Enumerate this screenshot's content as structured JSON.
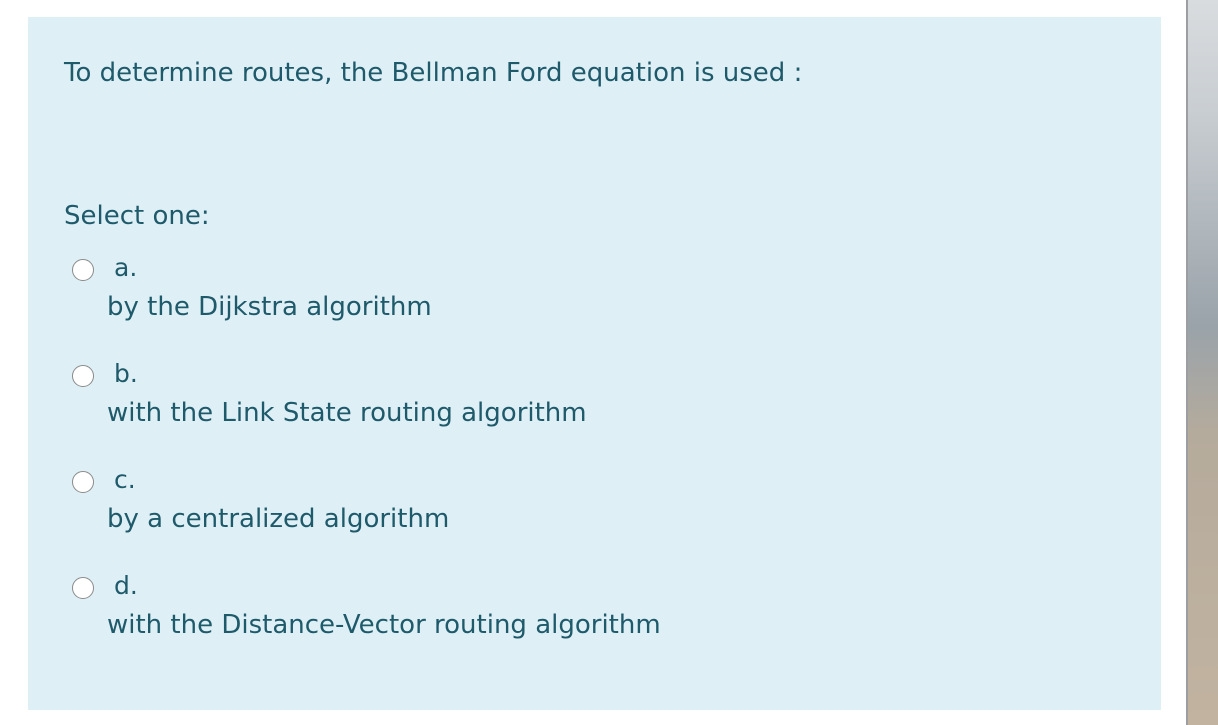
{
  "question": {
    "text": "To determine routes, the Bellman Ford equation is used :",
    "prompt": "Select one:"
  },
  "options": [
    {
      "letter": "a.",
      "text": "by the Dijkstra algorithm",
      "selected": false
    },
    {
      "letter": "b.",
      "text": "with the Link State routing algorithm",
      "selected": false
    },
    {
      "letter": "c.",
      "text": "by a centralized algorithm",
      "selected": false
    },
    {
      "letter": "d.",
      "text": "with the Distance-Vector routing algorithm",
      "selected": false
    }
  ],
  "colors": {
    "card_background": "#def0f6",
    "text": "#1f5a6b",
    "radio_border": "#8a8a8a"
  }
}
